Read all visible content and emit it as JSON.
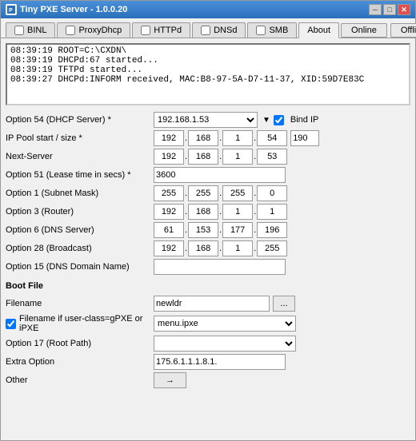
{
  "window": {
    "title": "Tiny PXE Server - 1.0.0.20",
    "min_btn": "─",
    "max_btn": "□",
    "close_btn": "✕"
  },
  "tabs": [
    {
      "id": "binl",
      "label": "BINL",
      "has_checkbox": true,
      "checked": false,
      "active": false
    },
    {
      "id": "proxydhcp",
      "label": "ProxyDhcp",
      "has_checkbox": true,
      "checked": false,
      "active": false
    },
    {
      "id": "httpd",
      "label": "HTTPd",
      "has_checkbox": true,
      "checked": false,
      "active": false
    },
    {
      "id": "dnsd",
      "label": "DNSd",
      "has_checkbox": true,
      "checked": false,
      "active": false
    },
    {
      "id": "smb",
      "label": "SMB",
      "has_checkbox": true,
      "checked": false,
      "active": false
    },
    {
      "id": "about",
      "label": "About",
      "has_checkbox": false,
      "checked": false,
      "active": true
    }
  ],
  "action_buttons": {
    "online": "Online",
    "offline": "Offline"
  },
  "log": {
    "lines": [
      "08:39:19 ROOT=C:\\CXDN\\",
      "08:39:19 DHCPd:67 started...",
      "08:39:19 TFTPd started...",
      "08:39:27 DHCPd:INFORM received, MAC:B8-97-5A-D7-11-37, XID:59D7E83C"
    ]
  },
  "form": {
    "option54_label": "Option 54 (DHCP Server) *",
    "option54_value": "192.168.1.53",
    "bind_ip_label": "Bind IP",
    "bind_ip_checked": true,
    "pool_label": "IP Pool start / size *",
    "pool_ip": {
      "a": "192",
      "b": "168",
      "c": "1",
      "d": "54"
    },
    "pool_size": "190",
    "nextserver_label": "Next-Server",
    "nextserver_ip": {
      "a": "192",
      "b": "168",
      "c": "1",
      "d": "53"
    },
    "option51_label": "Option 51 (Lease time in secs) *",
    "option51_value": "3600",
    "option1_label": "Option 1  (Subnet Mask)",
    "option1_ip": {
      "a": "255",
      "b": "255",
      "c": "255",
      "d": "0"
    },
    "option3_label": "Option 3  (Router)",
    "option3_ip": {
      "a": "192",
      "b": "168",
      "c": "1",
      "d": "1"
    },
    "option6_label": "Option 6  (DNS Server)",
    "option6_ip": {
      "a": "61",
      "b": "153",
      "c": "177",
      "d": "196"
    },
    "option28_label": "Option 28  (Broadcast)",
    "option28_ip": {
      "a": "192",
      "b": "168",
      "c": "1",
      "d": "255"
    },
    "option15_label": "Option 15 (DNS Domain Name)",
    "option15_value": "",
    "boot_file_label": "Boot File",
    "filename_label": "Filename",
    "filename_value": "newldr",
    "browse_label": "...",
    "userclass_label": "Filename if user-class=gPXE or iPXE",
    "userclass_checked": true,
    "userclass_value": "menu.ipxe",
    "option17_label": "Option 17 (Root Path)",
    "option17_value": "",
    "extra_label": "Extra Option",
    "extra_value": "175.6.1.1.1.8.1.",
    "other_label": "Other",
    "other_btn_label": "→"
  }
}
